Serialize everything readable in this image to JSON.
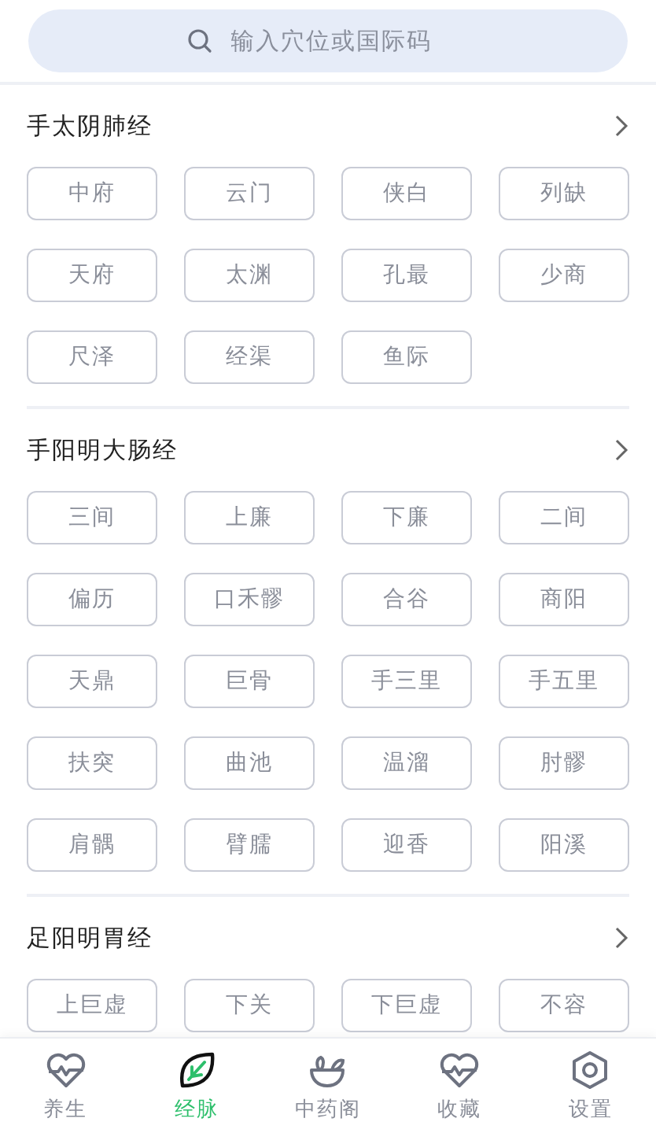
{
  "search": {
    "placeholder": "输入穴位或国际码"
  },
  "sections": [
    {
      "title": "手太阴肺经",
      "points": [
        "中府",
        "云门",
        "侠白",
        "列缺",
        "天府",
        "太渊",
        "孔最",
        "少商",
        "尺泽",
        "经渠",
        "鱼际"
      ]
    },
    {
      "title": "手阳明大肠经",
      "points": [
        "三间",
        "上廉",
        "下廉",
        "二间",
        "偏历",
        "口禾髎",
        "合谷",
        "商阳",
        "天鼎",
        "巨骨",
        "手三里",
        "手五里",
        "扶突",
        "曲池",
        "温溜",
        "肘髎",
        "肩髃",
        "臂臑",
        "迎香",
        "阳溪"
      ]
    },
    {
      "title": "足阳明胃经",
      "points": [
        "上巨虚",
        "下关",
        "下巨虚",
        "不容"
      ]
    }
  ],
  "tabs": [
    {
      "label": "养生",
      "kind": "heart",
      "selected": false
    },
    {
      "label": "经脉",
      "kind": "leaf",
      "selected": true
    },
    {
      "label": "中药阁",
      "kind": "bowl",
      "selected": false
    },
    {
      "label": "收藏",
      "kind": "heart",
      "selected": false
    },
    {
      "label": "设置",
      "kind": "gear",
      "selected": false
    }
  ]
}
